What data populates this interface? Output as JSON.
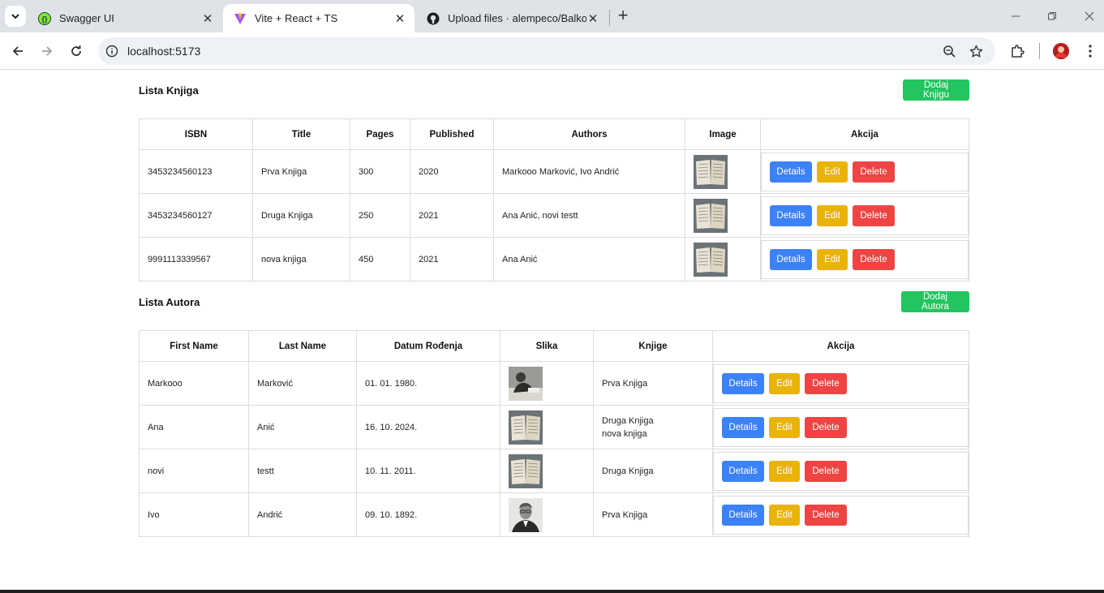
{
  "browser": {
    "tabs": [
      {
        "label": "Swagger UI",
        "active": false
      },
      {
        "label": "Vite + React + TS",
        "active": true
      },
      {
        "label": "Upload files · alempeco/Balkon",
        "active": false
      }
    ],
    "url": "localhost:5173"
  },
  "books": {
    "title": "Lista Knjiga",
    "add_label": "Dodaj Knjigu",
    "headers": [
      "ISBN",
      "Title",
      "Pages",
      "Published",
      "Authors",
      "Image",
      "Akcija"
    ],
    "rows": [
      {
        "isbn": "3453234560123",
        "title": "Prva Knjiga",
        "pages": "300",
        "published": "2020",
        "authors": "Markooo Marković, Ivo Andrić"
      },
      {
        "isbn": "3453234560127",
        "title": "Druga Knjiga",
        "pages": "250",
        "published": "2021",
        "authors": "Ana Anić, novi testt"
      },
      {
        "isbn": "9991113339567",
        "title": "nova knjiga",
        "pages": "450",
        "published": "2021",
        "authors": "Ana Anić"
      }
    ]
  },
  "authors": {
    "title": "Lista Autora",
    "add_label": "Dodaj Autora",
    "headers": [
      "First Name",
      "Last Name",
      "Datum Rođenja",
      "Slika",
      "Knjige",
      "Akcija"
    ],
    "rows": [
      {
        "first": "Markooo",
        "last": "Marković",
        "dob": "01. 01. 1980.",
        "books": [
          "Prva Knjiga"
        ]
      },
      {
        "first": "Ana",
        "last": "Anić",
        "dob": "16. 10. 2024.",
        "books": [
          "Druga Knjiga",
          "nova knjiga"
        ]
      },
      {
        "first": "novi",
        "last": "testt",
        "dob": "10. 11. 2011.",
        "books": [
          "Druga Knjiga"
        ]
      },
      {
        "first": "Ivo",
        "last": "Andrić",
        "dob": "09. 10. 1892.",
        "books": [
          "Prva Knjiga"
        ]
      }
    ]
  },
  "actions": {
    "details": "Details",
    "edit": "Edit",
    "delete": "Delete"
  },
  "colors": {
    "details": "#3b82f6",
    "edit": "#eab308",
    "delete": "#ef4444",
    "add": "#22c55e"
  }
}
